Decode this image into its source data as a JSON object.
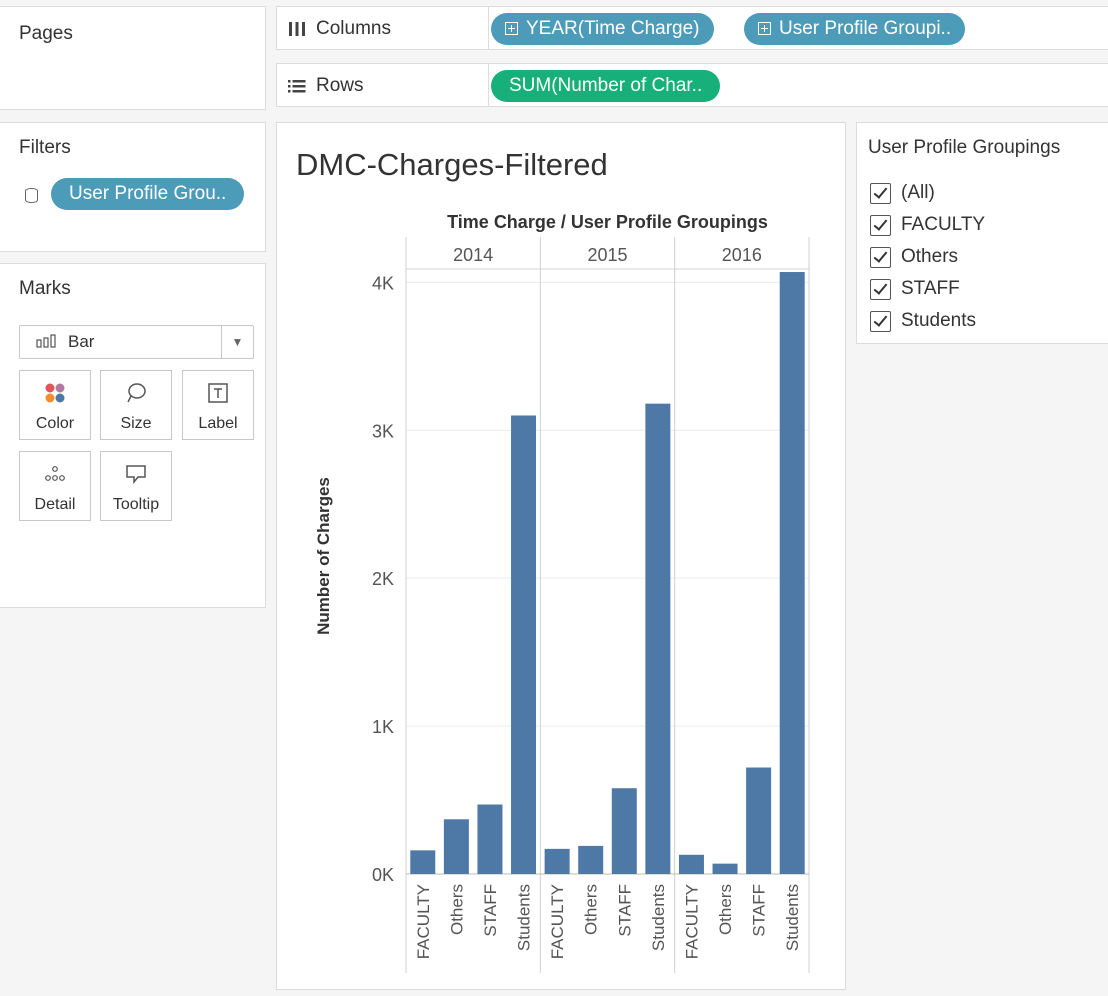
{
  "pages": {
    "title": "Pages"
  },
  "columns": {
    "label": "Columns",
    "pills": [
      "YEAR(Time Charge)",
      "User Profile Groupi.."
    ]
  },
  "rows": {
    "label": "Rows",
    "pills": [
      "SUM(Number of Char.."
    ]
  },
  "filters": {
    "title": "Filters",
    "pills": [
      "User Profile Grou.."
    ]
  },
  "marks": {
    "title": "Marks",
    "type": "Bar",
    "buttons": [
      "Color",
      "Size",
      "Label",
      "Detail",
      "Tooltip"
    ],
    "button_icons": [
      "color-dots-icon",
      "size-lasso-icon",
      "label-text-icon",
      "detail-dots-icon",
      "tooltip-bubble-icon"
    ]
  },
  "legend": {
    "title": "User Profile Groupings",
    "options": [
      "(All)",
      "FACULTY",
      "Others",
      "STAFF",
      "Students"
    ]
  },
  "colors": {
    "bar": "#4e79a7",
    "pill_dimension": "#4b9bb9",
    "pill_measure": "#17b07a"
  },
  "chart_data": {
    "type": "bar",
    "title": "DMC-Charges-Filtered",
    "header": "Time Charge / User Profile Groupings",
    "ylabel": "Number of Charges",
    "ylim": [
      0,
      4300
    ],
    "yticks": [
      0,
      1000,
      2000,
      3000,
      4000
    ],
    "ytick_labels": [
      "0K",
      "1K",
      "2K",
      "3K",
      "4K"
    ],
    "groups": [
      "2014",
      "2015",
      "2016"
    ],
    "categories": [
      "FACULTY",
      "Others",
      "STAFF",
      "Students"
    ],
    "values": [
      [
        160,
        370,
        470,
        3100
      ],
      [
        170,
        190,
        580,
        3180
      ],
      [
        130,
        70,
        720,
        4070
      ]
    ],
    "grid": true
  }
}
